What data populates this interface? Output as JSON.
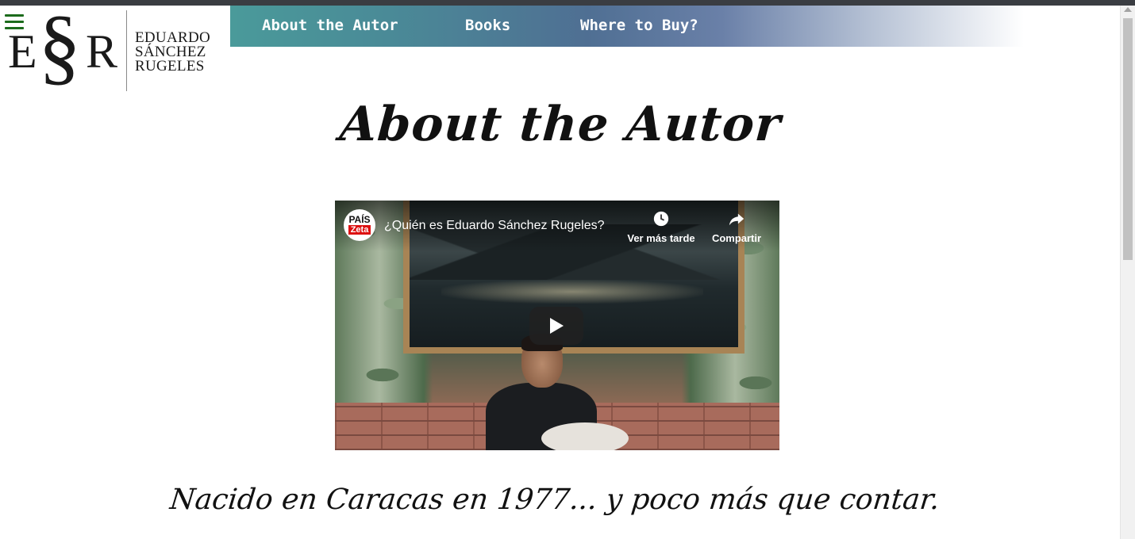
{
  "logo": {
    "monogram_left": "E",
    "monogram_mid": "§",
    "monogram_right": "R",
    "name_lines": [
      "EDUARDO",
      "SÁNCHEZ",
      "RUGELES"
    ]
  },
  "nav": {
    "items": [
      {
        "label": "About the Autor"
      },
      {
        "label": "Books"
      },
      {
        "label": "Where to Buy?"
      }
    ]
  },
  "page": {
    "title": "About the Autor",
    "tagline": "Nacido en Caracas en 1977... y poco más que contar."
  },
  "video": {
    "title": "¿Quién es Eduardo Sánchez Rugeles?",
    "channel_logo_top": "PAÍS",
    "channel_logo_bottom": "Zeta",
    "watch_later_label": "Ver más tarde",
    "share_label": "Compartir"
  },
  "colors": {
    "nav_gradient_start": "#4a9a9a",
    "nav_gradient_mid": "#4f6f93",
    "hamburger": "#1c6b1c",
    "text": "#111111"
  },
  "icons": {
    "menu": "hamburger-icon",
    "watch_later": "clock-icon",
    "share": "share-arrow-icon",
    "play": "play-icon"
  }
}
